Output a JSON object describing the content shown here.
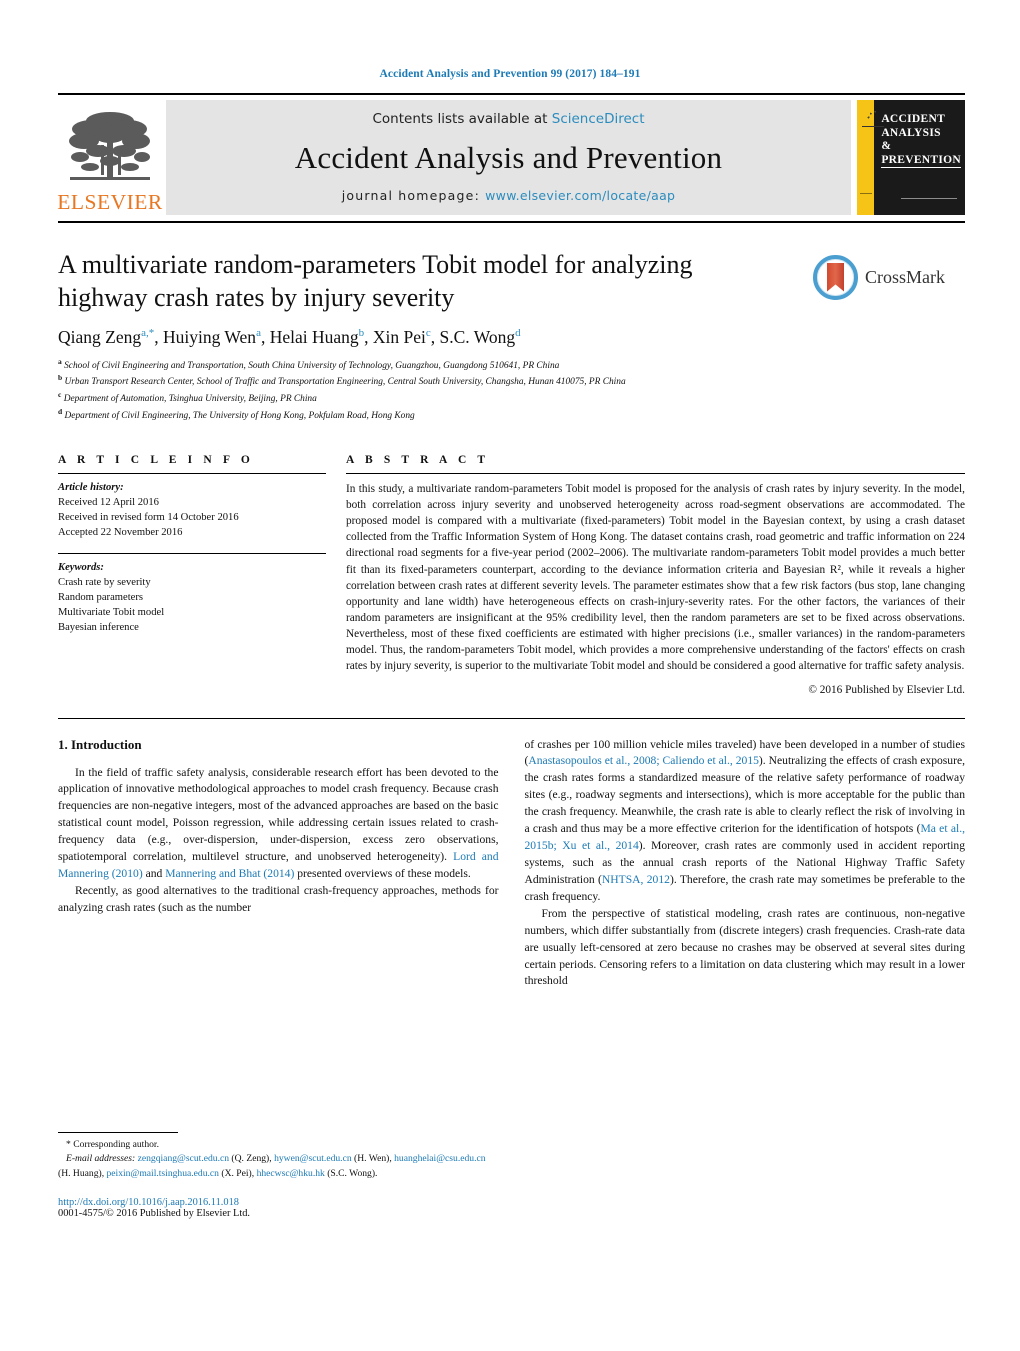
{
  "running_head": "Accident Analysis and Prevention 99 (2017) 184–191",
  "masthead": {
    "contents_prefix": "Contents lists available at ",
    "sciencedirect": "ScienceDirect",
    "journal_title": "Accident Analysis and Prevention",
    "homepage_label": "journal homepage: ",
    "homepage_url": "www.elsevier.com/locate/aap",
    "publisher": "ELSEVIER",
    "cover_line1": "ACCIDENT",
    "cover_line2": "ANALYSIS",
    "cover_line3": "&",
    "cover_line4": "PREVENTION"
  },
  "article": {
    "title": "A multivariate random-parameters Tobit model for analyzing highway crash rates by injury severity",
    "authors_html": "Qiang Zeng<sup>a,*</sup>, Huiying Wen<sup>a</sup>, Helai Huang<sup>b</sup>, Xin Pei<sup>c</sup>, S.C. Wong<sup>d</sup>",
    "affiliations": [
      {
        "mark": "a",
        "text": "School of Civil Engineering and Transportation, South China University of Technology, Guangzhou, Guangdong 510641, PR China"
      },
      {
        "mark": "b",
        "text": "Urban Transport Research Center, School of Traffic and Transportation Engineering, Central South University, Changsha, Hunan 410075, PR China"
      },
      {
        "mark": "c",
        "text": "Department of Automation, Tsinghua University, Beijing, PR China"
      },
      {
        "mark": "d",
        "text": "Department of Civil Engineering, The University of Hong Kong, Pokfulam Road, Hong Kong"
      }
    ],
    "crossmark_label": "CrossMark"
  },
  "article_info": {
    "heading": "A R T I C L E   I N F O",
    "history_label": "Article history:",
    "history": [
      "Received 12 April 2016",
      "Received in revised form 14 October 2016",
      "Accepted 22 November 2016"
    ],
    "keywords_label": "Keywords:",
    "keywords": [
      "Crash rate by severity",
      "Random parameters",
      "Multivariate Tobit model",
      "Bayesian inference"
    ]
  },
  "abstract": {
    "heading": "A B S T R A C T",
    "text": "In this study, a multivariate random-parameters Tobit model is proposed for the analysis of crash rates by injury severity. In the model, both correlation across injury severity and unobserved heterogeneity across road-segment observations are accommodated. The proposed model is compared with a multivariate (fixed-parameters) Tobit model in the Bayesian context, by using a crash dataset collected from the Traffic Information System of Hong Kong. The dataset contains crash, road geometric and traffic information on 224 directional road segments for a five-year period (2002–2006). The multivariate random-parameters Tobit model provides a much better fit than its fixed-parameters counterpart, according to the deviance information criteria and Bayesian R², while it reveals a higher correlation between crash rates at different severity levels. The parameter estimates show that a few risk factors (bus stop, lane changing opportunity and lane width) have heterogeneous effects on crash-injury-severity rates. For the other factors, the variances of their random parameters are insignificant at the 95% credibility level, then the random parameters are set to be fixed across observations. Nevertheless, most of these fixed coefficients are estimated with higher precisions (i.e., smaller variances) in the random-parameters model. Thus, the random-parameters Tobit model, which provides a more comprehensive understanding of the factors' effects on crash rates by injury severity, is superior to the multivariate Tobit model and should be considered a good alternative for traffic safety analysis.",
    "copyright": "© 2016 Published by Elsevier Ltd."
  },
  "introduction": {
    "heading": "1.  Introduction",
    "left_paragraphs": [
      "In the field of traffic safety analysis, considerable research effort has been devoted to the application of innovative methodological approaches to model crash frequency. Because crash frequencies are non-negative integers, most of the advanced approaches are based on the basic statistical count model, Poisson regression, while addressing certain issues related to crash-frequency data (e.g., over-dispersion, under-dispersion, excess zero observations, spatiotemporal correlation, multilevel structure, and unobserved heterogeneity). ",
      "Recently, as good alternatives to the traditional crash-frequency approaches, methods for analyzing crash rates (such as the number"
    ],
    "left_citations": {
      "c1": "Lord and Mannering (2010)",
      "c1_join": " and ",
      "c2": "Mannering and Bhat (2014)",
      "c2_tail": " presented overviews of these models."
    },
    "right_paragraphs": {
      "p1_a": "of crashes per 100 million vehicle miles traveled) have been developed in a number of studies (",
      "p1_cite": "Anastasopoulos et al., 2008; Caliendo et al., 2015",
      "p1_b": "). Neutralizing the effects of crash exposure, the crash rates forms a standardized measure of the relative safety performance of roadway sites (e.g., roadway segments and intersections), which is more acceptable for the public than the crash frequency. Meanwhile, the crash rate is able to clearly reflect the risk of involving in a crash and thus may be a more effective criterion for the identification of hotspots (",
      "p1_cite2": "Ma et al., 2015b; Xu et al., 2014",
      "p1_c": "). Moreover, crash rates are commonly used in accident reporting systems, such as the annual crash reports of the National Highway Traffic Safety Administration (",
      "p1_cite3": "NHTSA, 2012",
      "p1_d": "). Therefore, the crash rate may sometimes be preferable to the crash frequency.",
      "p2": "From the perspective of statistical modeling, crash rates are continuous, non-negative numbers, which differ substantially from (discrete integers) crash frequencies. Crash-rate data are usually left-censored at zero because no crashes may be observed at several sites during certain periods. Censoring refers to a limitation on data clustering which may result in a lower threshold"
    }
  },
  "footnote": {
    "corresponding": "* Corresponding author.",
    "email_label": "E-mail addresses:",
    "emails": [
      {
        "address": "zengqiang@scut.edu.cn",
        "person": " (Q. Zeng), "
      },
      {
        "address": "hywen@scut.edu.cn",
        "person": " (H. Wen), "
      },
      {
        "address": "huanghelai@csu.edu.cn",
        "person": " (H. Huang), "
      },
      {
        "address": "peixin@mail.tsinghua.edu.cn",
        "person": " (X. Pei), "
      },
      {
        "address": "hhecwsc@hku.hk",
        "person": " (S.C. Wong)."
      }
    ],
    "doi": "http://dx.doi.org/10.1016/j.aap.2016.11.018",
    "issn": "0001-4575/© 2016 Published by Elsevier Ltd."
  },
  "colors": {
    "link_blue": "#1c7ab5",
    "elsevier_orange": "#e87722",
    "cover_yellow": "#f6c416",
    "banner_grey": "#e4e4e4"
  }
}
